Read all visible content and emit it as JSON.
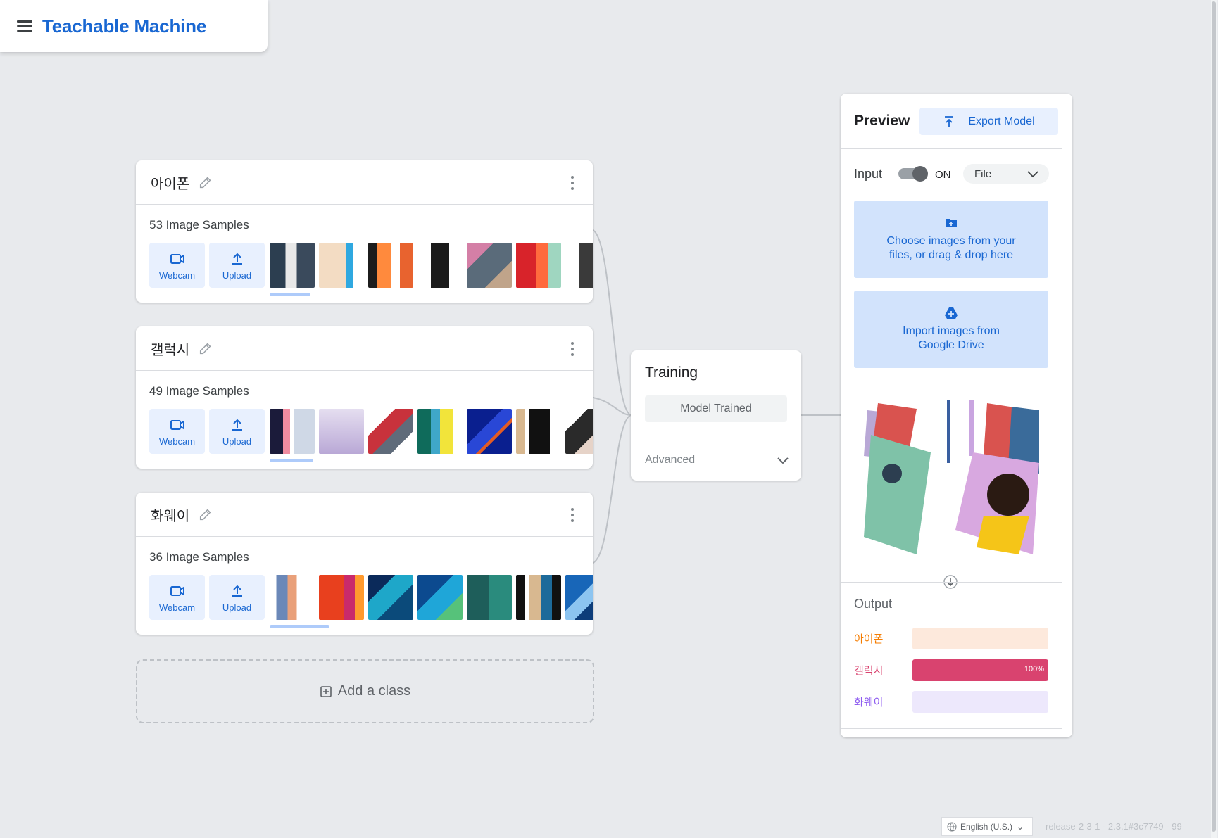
{
  "app": {
    "title": "Teachable Machine"
  },
  "classes": [
    {
      "name": "아이폰",
      "samples": "53 Image Samples",
      "webcam": "Webcam",
      "upload": "Upload"
    },
    {
      "name": "갤럭시",
      "samples": "49 Image Samples",
      "webcam": "Webcam",
      "upload": "Upload"
    },
    {
      "name": "화웨이",
      "samples": "36 Image Samples",
      "webcam": "Webcam",
      "upload": "Upload"
    }
  ],
  "add_class": "Add a class",
  "training": {
    "title": "Training",
    "status_button": "Model Trained",
    "advanced": "Advanced"
  },
  "preview": {
    "title": "Preview",
    "export": "Export Model",
    "input_label": "Input",
    "toggle_state": "ON",
    "source": "File",
    "choose_files_line1": "Choose images from your",
    "choose_files_line2": "files, or drag & drop here",
    "drive_line1": "Import images from",
    "drive_line2": "Google Drive",
    "output_label": "Output",
    "outputs": [
      {
        "name": "아이폰",
        "value": 0,
        "percent_label": "",
        "color": "#f57c00",
        "track": "#fde9dc"
      },
      {
        "name": "갤럭시",
        "value": 1.0,
        "percent_label": "100%",
        "color": "#d9436f",
        "track": "#fadbe4"
      },
      {
        "name": "화웨이",
        "value": 0,
        "percent_label": "",
        "color": "#8e5cf0",
        "track": "#ede8fc"
      }
    ]
  },
  "footer": {
    "language": "English (U.S.)",
    "release": "release-2-3-1 - 2.3.1#3c7749 - 99"
  },
  "colors": {
    "brand": "#1967d2",
    "button_bg": "#e8f0fe",
    "drop_bg": "#d2e3fc"
  }
}
